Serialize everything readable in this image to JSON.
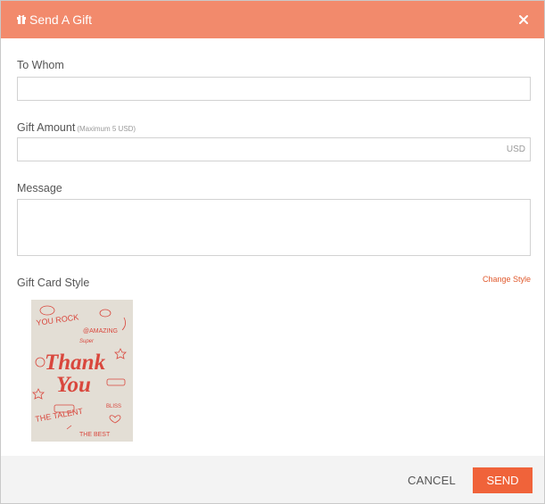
{
  "colors": {
    "accent": "#f28a6c",
    "primary": "#f0633a",
    "link": "#e05a2e",
    "card_bg": "#e3ded5",
    "card_ink": "#d9473d"
  },
  "header": {
    "icon": "gift-icon",
    "title": "Send A Gift",
    "close_icon": "close-icon"
  },
  "form": {
    "to_whom": {
      "label": "To Whom",
      "value": "",
      "placeholder": ""
    },
    "gift_amount": {
      "label": "Gift Amount",
      "hint": "(Maximum 5 USD)",
      "value": "",
      "unit": "USD"
    },
    "message": {
      "label": "Message",
      "value": ""
    },
    "gift_card_style": {
      "label": "Gift Card Style",
      "change_link": "Change Style"
    }
  },
  "card": {
    "texts": [
      "YOU ROCK",
      "@AMAZING",
      "Super",
      "Thank",
      "You",
      "THE TALENT",
      "THE BEST",
      "BLISS"
    ]
  },
  "footer": {
    "cancel_label": "CANCEL",
    "send_label": "SEND"
  }
}
